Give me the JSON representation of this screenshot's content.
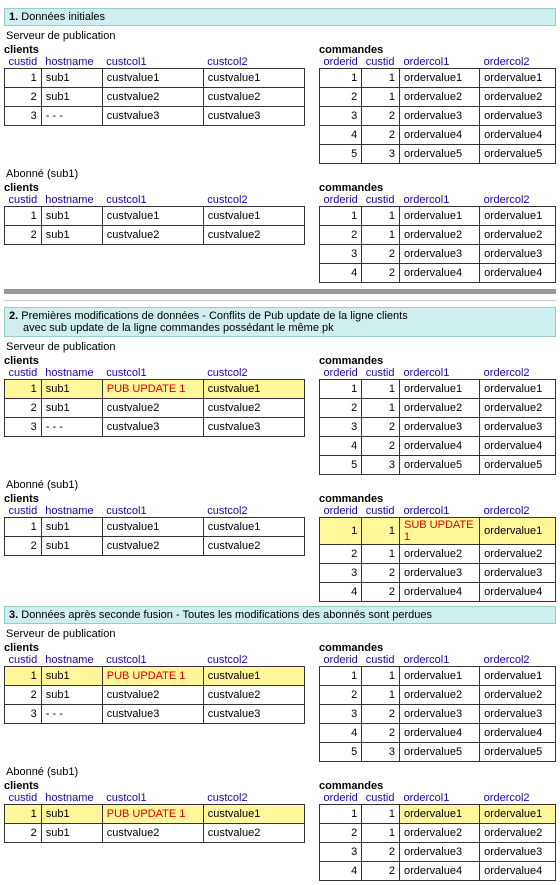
{
  "labels": {
    "publisher": "Serveur de publication",
    "subscriber": "Abonné (sub1)",
    "clients": "clients",
    "commands": "commandes"
  },
  "headers": {
    "clients": [
      "custid",
      "hostname",
      "custcol1",
      "custcol2"
    ],
    "commands": [
      "orderid",
      "custid",
      "ordercol1",
      "ordercol2"
    ]
  },
  "sections": [
    {
      "num": "1.",
      "title": "Données initiales",
      "line2": null
    },
    {
      "num": "2.",
      "title": "Premières modifications de données - Conflits de Pub update de la ligne clients",
      "line2": "avec sub update de la ligne commandes possédant le même pk"
    },
    {
      "num": "3.",
      "title": "Données après seconde fusion - Toutes les modifications des abonnés sont perdues",
      "line2": null
    }
  ],
  "s1": {
    "pub_clients": [
      [
        "1",
        "sub1",
        "custvalue1",
        "custvalue1"
      ],
      [
        "2",
        "sub1",
        "custvalue2",
        "custvalue2"
      ],
      [
        "3",
        "- - -",
        "custvalue3",
        "custvalue3"
      ]
    ],
    "pub_cmds": [
      [
        "1",
        "1",
        "ordervalue1",
        "ordervalue1"
      ],
      [
        "2",
        "1",
        "ordervalue2",
        "ordervalue2"
      ],
      [
        "3",
        "2",
        "ordervalue3",
        "ordervalue3"
      ],
      [
        "4",
        "2",
        "ordervalue4",
        "ordervalue4"
      ],
      [
        "5",
        "3",
        "ordervalue5",
        "ordervalue5"
      ]
    ],
    "sub_clients": [
      [
        "1",
        "sub1",
        "custvalue1",
        "custvalue1"
      ],
      [
        "2",
        "sub1",
        "custvalue2",
        "custvalue2"
      ]
    ],
    "sub_cmds": [
      [
        "1",
        "1",
        "ordervalue1",
        "ordervalue1"
      ],
      [
        "2",
        "1",
        "ordervalue2",
        "ordervalue2"
      ],
      [
        "3",
        "2",
        "ordervalue3",
        "ordervalue3"
      ],
      [
        "4",
        "2",
        "ordervalue4",
        "ordervalue4"
      ]
    ]
  },
  "s2": {
    "pub_clients": [
      [
        "1",
        "sub1",
        "PUB UPDATE 1",
        "custvalue1"
      ],
      [
        "2",
        "sub1",
        "custvalue2",
        "custvalue2"
      ],
      [
        "3",
        "- - -",
        "custvalue3",
        "custvalue3"
      ]
    ],
    "pub_cmds": [
      [
        "1",
        "1",
        "ordervalue1",
        "ordervalue1"
      ],
      [
        "2",
        "1",
        "ordervalue2",
        "ordervalue2"
      ],
      [
        "3",
        "2",
        "ordervalue3",
        "ordervalue3"
      ],
      [
        "4",
        "2",
        "ordervalue4",
        "ordervalue4"
      ],
      [
        "5",
        "3",
        "ordervalue5",
        "ordervalue5"
      ]
    ],
    "sub_clients": [
      [
        "1",
        "sub1",
        "custvalue1",
        "custvalue1"
      ],
      [
        "2",
        "sub1",
        "custvalue2",
        "custvalue2"
      ]
    ],
    "sub_cmds": [
      [
        "1",
        "1",
        "SUB UPDATE 1",
        "ordervalue1"
      ],
      [
        "2",
        "1",
        "ordervalue2",
        "ordervalue2"
      ],
      [
        "3",
        "2",
        "ordervalue3",
        "ordervalue3"
      ],
      [
        "4",
        "2",
        "ordervalue4",
        "ordervalue4"
      ]
    ]
  },
  "s3": {
    "pub_clients": [
      [
        "1",
        "sub1",
        "PUB UPDATE 1",
        "custvalue1"
      ],
      [
        "2",
        "sub1",
        "custvalue2",
        "custvalue2"
      ],
      [
        "3",
        "- - -",
        "custvalue3",
        "custvalue3"
      ]
    ],
    "pub_cmds": [
      [
        "1",
        "1",
        "ordervalue1",
        "ordervalue1"
      ],
      [
        "2",
        "1",
        "ordervalue2",
        "ordervalue2"
      ],
      [
        "3",
        "2",
        "ordervalue3",
        "ordervalue3"
      ],
      [
        "4",
        "2",
        "ordervalue4",
        "ordervalue4"
      ],
      [
        "5",
        "3",
        "ordervalue5",
        "ordervalue5"
      ]
    ],
    "sub_clients": [
      [
        "1",
        "sub1",
        "PUB UPDATE 1",
        "custvalue1"
      ],
      [
        "2",
        "sub1",
        "custvalue2",
        "custvalue2"
      ]
    ],
    "sub_cmds": [
      [
        "1",
        "1",
        "ordervalue1",
        "ordervalue1"
      ],
      [
        "2",
        "1",
        "ordervalue2",
        "ordervalue2"
      ],
      [
        "3",
        "2",
        "ordervalue3",
        "ordervalue3"
      ],
      [
        "4",
        "2",
        "ordervalue4",
        "ordervalue4"
      ]
    ]
  },
  "highlights": {
    "s2_pub_clients": {
      "row": 0,
      "updCol": 2
    },
    "s2_sub_cmds": {
      "row": 0,
      "updCol": 2
    },
    "s3_pub_clients": {
      "row": 0,
      "updCol": 2
    },
    "s3_sub_clients": {
      "row": 0,
      "updCol": 2
    },
    "s3_sub_cmds": {
      "row": 0,
      "hlCols": [
        2,
        3
      ]
    }
  }
}
